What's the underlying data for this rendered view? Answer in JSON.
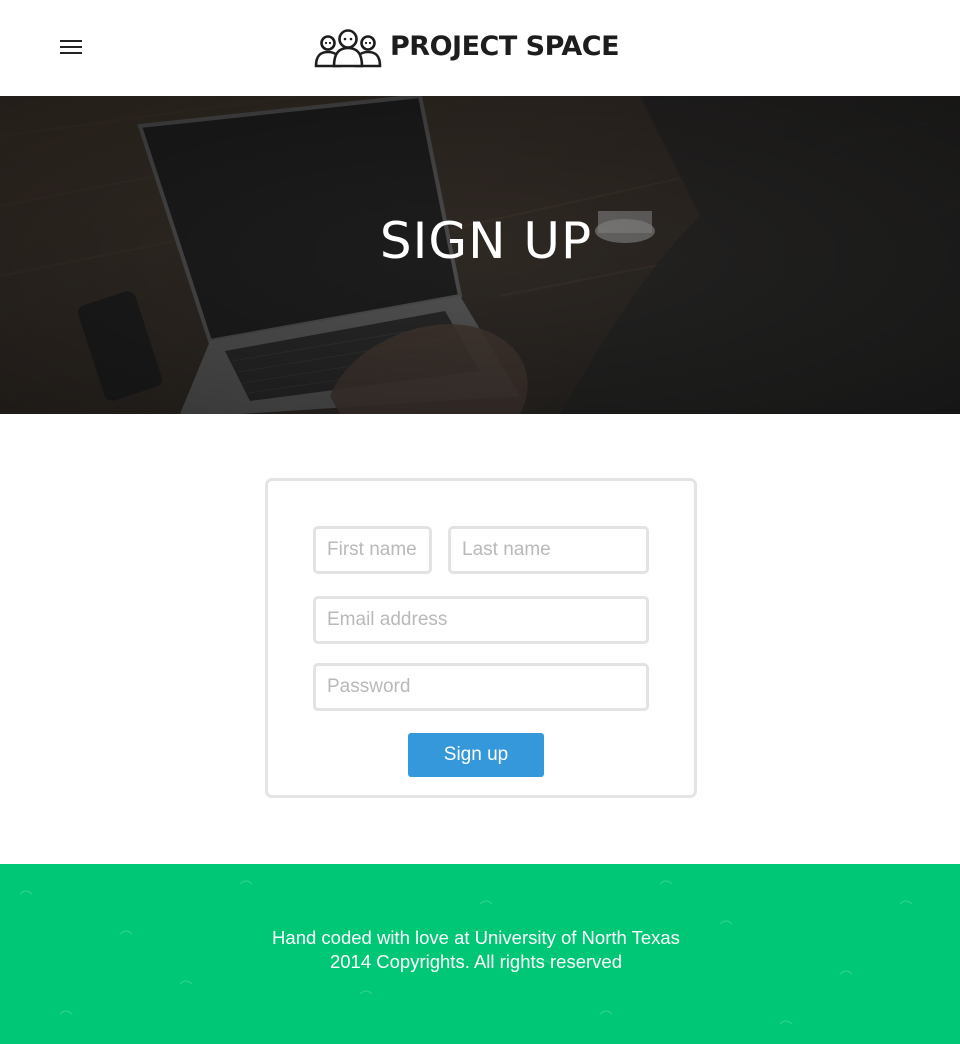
{
  "header": {
    "menu_icon": "hamburger-menu-icon",
    "logo_icon": "people-group-icon",
    "logo_text": "PROJECT SPACE"
  },
  "hero": {
    "title": "SIGN UP",
    "background": "laptop-desk-photo"
  },
  "form": {
    "first_name_placeholder": "First name",
    "last_name_placeholder": "Last name",
    "email_placeholder": "Email address",
    "password_placeholder": "Password",
    "submit_label": "Sign up"
  },
  "footer": {
    "line1": "Hand coded with love at University of North Texas",
    "line2": "2014 Copyrights. All rights reserved"
  },
  "colors": {
    "accent_button": "#3498db",
    "footer_bg": "#00c775",
    "hero_overlay": "#2b2b2b"
  }
}
